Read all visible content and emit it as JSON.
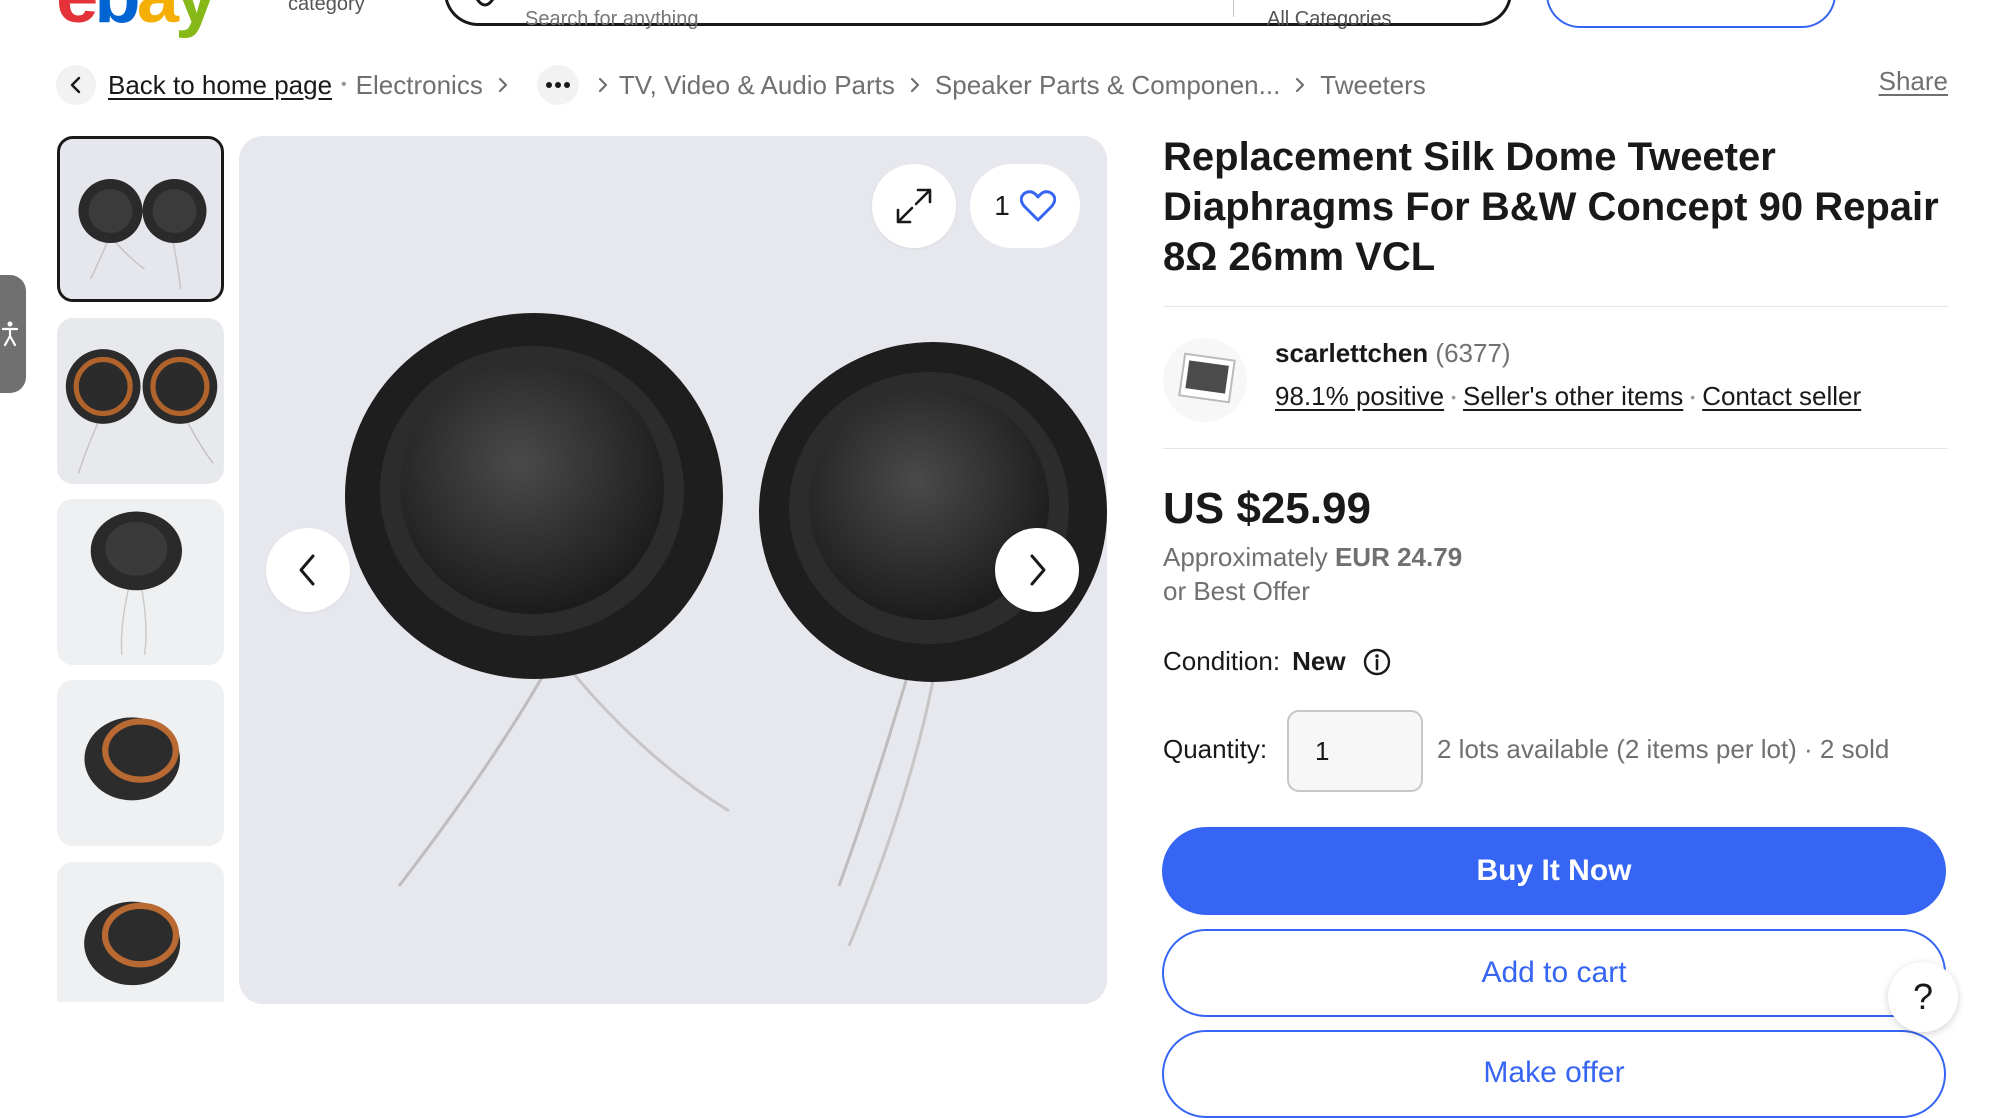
{
  "header": {
    "logo": [
      "e",
      "b",
      "a",
      "y"
    ],
    "category_label": "category",
    "search_placeholder": "Search for anything",
    "category_dropdown": "All Categories"
  },
  "breadcrumb": {
    "back_label": "Back to home page",
    "items": [
      "Electronics",
      "TV, Video & Audio Parts",
      "Speaker Parts & Componen...",
      "Tweeters"
    ],
    "share_label": "Share"
  },
  "gallery": {
    "thumbnail_count": 5,
    "selected_index": 0,
    "favorite_count": "1"
  },
  "listing": {
    "title": "Replacement Silk Dome Tweeter Diaphragms For B&W Concept 90 Repair 8Ω 26mm VCL",
    "seller": {
      "name": "scarlettchen",
      "feedback_count": "(6377)",
      "positive": "98.1% positive",
      "other_items": "Seller's other items",
      "contact": "Contact seller"
    },
    "price": "US $25.99",
    "approx_prefix": "Approximately",
    "approx_value": "EUR 24.79",
    "best_offer": "or Best Offer",
    "condition_label": "Condition:",
    "condition_value": "New",
    "quantity_label": "Quantity:",
    "quantity_value": "1",
    "availability": "2 lots available (2 items per lot) · 2 sold",
    "buttons": {
      "buy_now": "Buy It Now",
      "add_to_cart": "Add to cart",
      "make_offer": "Make offer"
    }
  },
  "help_label": "?",
  "colors": {
    "accent": "#3665f3",
    "text": "#191919",
    "muted": "#707070"
  }
}
